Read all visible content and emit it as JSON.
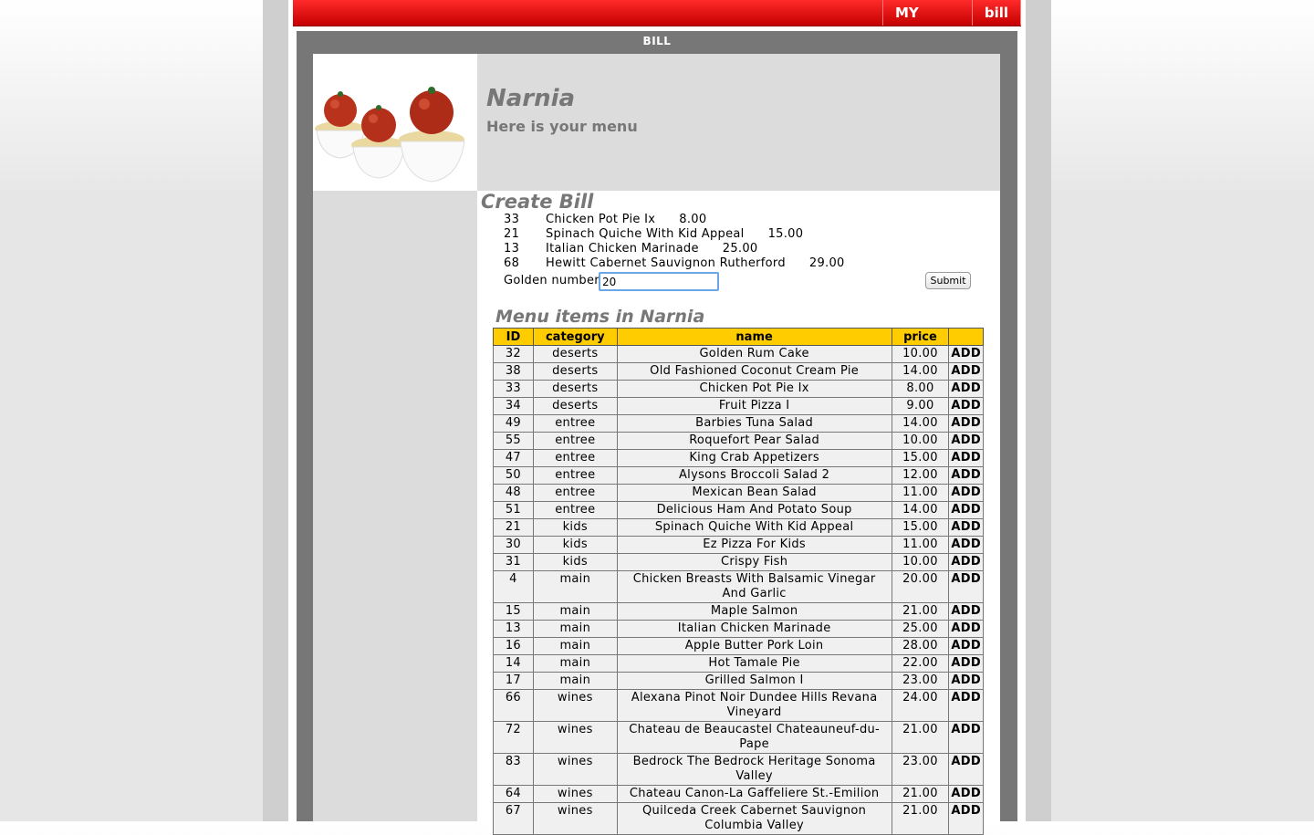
{
  "nav": {
    "links": [
      "MY INFO",
      "bill"
    ]
  },
  "frame": {
    "title": "BILL"
  },
  "hero": {
    "title": "Narnia",
    "subtitle": "Here is your menu",
    "image_icon": "meatball-pasta-bowls-image"
  },
  "create_bill": {
    "title": "Create Bill",
    "items": [
      {
        "id": "33",
        "name": "Chicken Pot Pie Ix",
        "price": "8.00"
      },
      {
        "id": "21",
        "name": "Spinach Quiche With Kid Appeal",
        "price": "15.00"
      },
      {
        "id": "13",
        "name": "Italian Chicken Marinade",
        "price": "25.00"
      },
      {
        "id": "68",
        "name": "Hewitt Cabernet Sauvignon Rutherford",
        "price": "29.00"
      }
    ],
    "golden_label": "Golden number",
    "golden_value": "20",
    "submit_label": "Submit"
  },
  "menu": {
    "title": "Menu items in Narnia",
    "columns": [
      "ID",
      "category",
      "name",
      "price",
      ""
    ],
    "add_label": "ADD",
    "rows": [
      [
        "32",
        "deserts",
        "Golden Rum Cake",
        "10.00"
      ],
      [
        "38",
        "deserts",
        "Old Fashioned Coconut Cream Pie",
        "14.00"
      ],
      [
        "33",
        "deserts",
        "Chicken Pot Pie Ix",
        "8.00"
      ],
      [
        "34",
        "deserts",
        "Fruit Pizza I",
        "9.00"
      ],
      [
        "49",
        "entree",
        "Barbies Tuna Salad",
        "14.00"
      ],
      [
        "55",
        "entree",
        "Roquefort Pear Salad",
        "10.00"
      ],
      [
        "47",
        "entree",
        "King Crab Appetizers",
        "15.00"
      ],
      [
        "50",
        "entree",
        "Alysons Broccoli Salad 2",
        "12.00"
      ],
      [
        "48",
        "entree",
        "Mexican Bean Salad",
        "11.00"
      ],
      [
        "51",
        "entree",
        "Delicious Ham And Potato Soup",
        "14.00"
      ],
      [
        "21",
        "kids",
        "Spinach Quiche With Kid Appeal",
        "15.00"
      ],
      [
        "30",
        "kids",
        "Ez Pizza For Kids",
        "11.00"
      ],
      [
        "31",
        "kids",
        "Crispy Fish",
        "10.00"
      ],
      [
        "4",
        "main",
        "Chicken Breasts With Balsamic Vinegar And Garlic",
        "20.00"
      ],
      [
        "15",
        "main",
        "Maple Salmon",
        "21.00"
      ],
      [
        "13",
        "main",
        "Italian Chicken Marinade",
        "25.00"
      ],
      [
        "16",
        "main",
        "Apple Butter Pork Loin",
        "28.00"
      ],
      [
        "14",
        "main",
        "Hot Tamale Pie",
        "22.00"
      ],
      [
        "17",
        "main",
        "Grilled Salmon I",
        "23.00"
      ],
      [
        "66",
        "wines",
        "Alexana Pinot Noir Dundee Hills Revana Vineyard",
        "24.00"
      ],
      [
        "72",
        "wines",
        "Chateau de Beaucastel Chateauneuf-du-Pape",
        "21.00"
      ],
      [
        "83",
        "wines",
        "Bedrock The Bedrock Heritage Sonoma Valley",
        "23.00"
      ],
      [
        "64",
        "wines",
        "Chateau Canon-La Gaffeliere St.-Emilion",
        "21.00"
      ],
      [
        "67",
        "wines",
        "Quilceda Creek Cabernet Sauvignon Columbia Valley",
        "21.00"
      ]
    ]
  }
}
